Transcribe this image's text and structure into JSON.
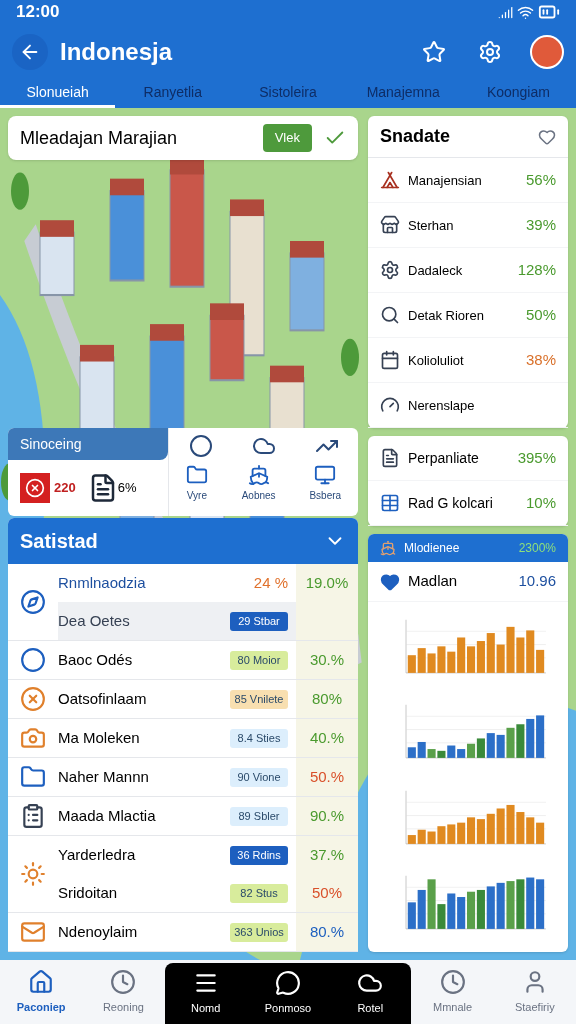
{
  "status_bar": {
    "time": "12:00"
  },
  "header": {
    "title": "Indonesja"
  },
  "tabs": [
    {
      "label": "Slonueiah",
      "selected": true
    },
    {
      "label": "Ranyetlia",
      "selected": false
    },
    {
      "label": "Sistoleira",
      "selected": false
    },
    {
      "label": "Manajemna",
      "selected": false
    },
    {
      "label": "Koongiam",
      "selected": false
    }
  ],
  "search_card": {
    "text": "Mleadajan Marajian",
    "button": "Vlek"
  },
  "shortcut_panel": {
    "title": "Sinoceing",
    "badge_value": "220",
    "doc_value": "6%",
    "tools": [
      "Vyre",
      "Aobnes",
      "Bsbera"
    ]
  },
  "stats": {
    "title": "Satistad",
    "expanded": true,
    "rows": [
      {
        "lines": [
          {
            "name": "Rnmlnaodzia",
            "selected": false,
            "mid": {
              "text": "24 %",
              "color": "#e0712c"
            },
            "value": {
              "text": "19.0%",
              "color": "#4a9a2e"
            }
          },
          {
            "name": "Dea Oetes",
            "selected": true,
            "tag": {
              "text": "29 Stbar",
              "color": "#1d5fbf"
            }
          }
        ]
      },
      {
        "lines": [
          {
            "name": "Baoc Odés",
            "selected": false,
            "tag": {
              "text": "80 Moior",
              "color": "#d8ec9c"
            },
            "value": {
              "text": "30.%",
              "color": "#4a9a2e"
            }
          }
        ]
      },
      {
        "lines": [
          {
            "name": "Oatsofinlaam",
            "selected": false,
            "tag": {
              "text": "85 Vnilete",
              "color": "#f8dfb0"
            },
            "value": {
              "text": "80%",
              "color": "#4a9a2e"
            }
          }
        ]
      },
      {
        "lines": [
          {
            "name": "Ma Moleken",
            "selected": false,
            "tag": {
              "text": "8.4 Sties",
              "color": "#dceefc"
            },
            "value": {
              "text": "40.%",
              "color": "#4a9a2e"
            }
          }
        ]
      },
      {
        "lines": [
          {
            "name": "Naher Mannn",
            "selected": false,
            "tag": {
              "text": "90 Vione",
              "color": "#dceefc"
            },
            "value": {
              "text": "50.%",
              "color": "#d9502a"
            }
          }
        ]
      },
      {
        "lines": [
          {
            "name": "Maada Mlactia",
            "selected": false,
            "tag": {
              "text": "89 Sbler",
              "color": "#dceefc"
            },
            "value": {
              "text": "90.%",
              "color": "#4a9a2e"
            }
          }
        ]
      },
      {
        "lines": [
          {
            "name": "Yarderledra",
            "selected": false,
            "tag": {
              "text": "36 Rdins",
              "color": "#1d5fbf"
            },
            "value": {
              "text": "37.%",
              "color": "#4a9a2e"
            }
          },
          {
            "name": "Sridoitan",
            "selected": false,
            "tag": {
              "text": "82 Stus",
              "color": "#d8ec9c"
            },
            "value": {
              "text": "50%",
              "color": "#d9502a"
            }
          }
        ]
      },
      {
        "lines": [
          {
            "name": "Ndenoylaim",
            "selected": false,
            "tag": {
              "text": "363 Unios",
              "color": "#d8ec9c"
            },
            "value": {
              "text": "80.%",
              "color": "#1d5fbf"
            }
          }
        ]
      }
    ]
  },
  "summary_card": {
    "title": "Snadate",
    "items": [
      {
        "name": "Manajensian",
        "value": {
          "text": "56%",
          "color": "#4a9a2e"
        }
      },
      {
        "name": "Sterhan",
        "value": {
          "text": "39%",
          "color": "#4a9a2e"
        }
      },
      {
        "name": "Dadaleck",
        "value": {
          "text": "128%",
          "color": "#4a9a2e"
        }
      },
      {
        "name": "Detak Rioren",
        "value": {
          "text": "50%",
          "color": "#4a9a2e"
        }
      },
      {
        "name": "Kolioluliot",
        "value": {
          "text": "38%",
          "color": "#d9702a"
        }
      },
      {
        "name": "Nerenslape"
      }
    ]
  },
  "report_card": {
    "items": [
      {
        "name": "Perpanliate",
        "value": {
          "text": "395%",
          "color": "#4a9a2e"
        }
      },
      {
        "name": "Rad G kolcari",
        "value": {
          "text": "10%",
          "color": "#4a9a2e"
        }
      }
    ]
  },
  "chart_card": {
    "title": "Mlodienee",
    "title_value": "2300%",
    "label": "Madlan",
    "label_value": "10.96"
  },
  "bottom_nav": [
    {
      "label": "Paconiep",
      "selected": true,
      "kind": "plain"
    },
    {
      "label": "Reoning",
      "selected": false,
      "kind": "plain"
    },
    {
      "label": "Nomd",
      "selected": false,
      "kind": "featured"
    },
    {
      "label": "Ponmoso",
      "selected": false,
      "kind": "featured"
    },
    {
      "label": "Rotel",
      "selected": false,
      "kind": "featured"
    },
    {
      "label": "Mmnale",
      "selected": false,
      "kind": "plain"
    },
    {
      "label": "Staefiriy",
      "selected": false,
      "kind": "plain"
    }
  ]
}
